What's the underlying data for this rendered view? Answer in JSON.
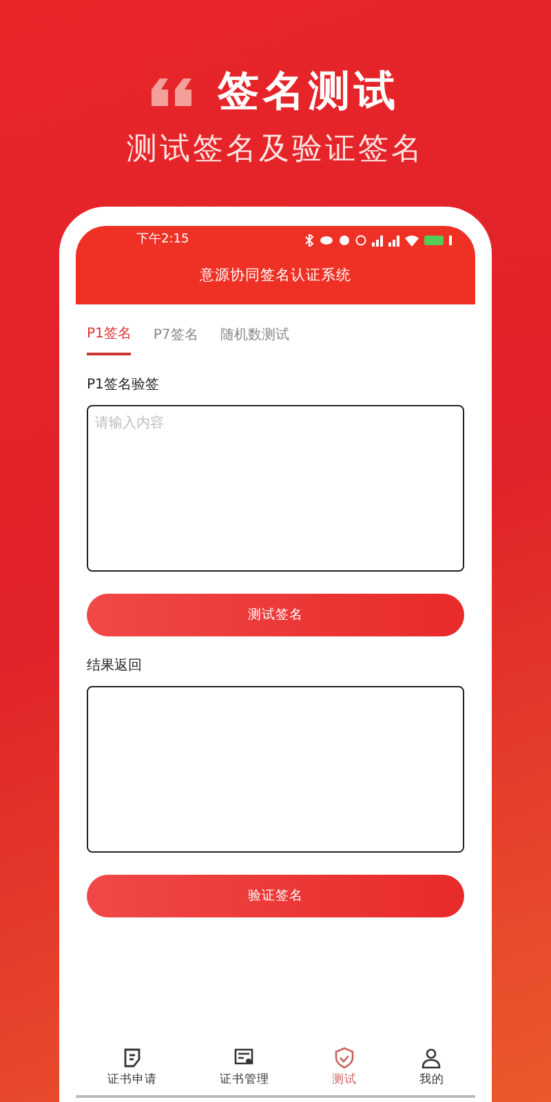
{
  "promo": {
    "headline": "签名测试",
    "subtitle": "测试签名及验证签名"
  },
  "status_bar": {
    "time": "下午2:15"
  },
  "app_bar": {
    "title": "意源协同签名认证系统"
  },
  "tabs": [
    {
      "label": "P1签名",
      "selected": true
    },
    {
      "label": "P7签名",
      "selected": false
    },
    {
      "label": "随机数测试",
      "selected": false
    }
  ],
  "form": [
    {
      "kind": "textarea",
      "label": "P1签名验签",
      "placeholder": "请输入内容"
    },
    {
      "kind": "button",
      "label": "测试签名"
    },
    {
      "kind": "textarea",
      "label": "结果返回"
    },
    {
      "kind": "button",
      "label": "验证签名"
    }
  ],
  "bottom_nav": [
    {
      "label": "证书申请",
      "selected": false
    },
    {
      "label": "证书管理",
      "selected": false
    },
    {
      "label": "测试",
      "selected": true
    },
    {
      "label": "我的",
      "selected": false
    }
  ]
}
